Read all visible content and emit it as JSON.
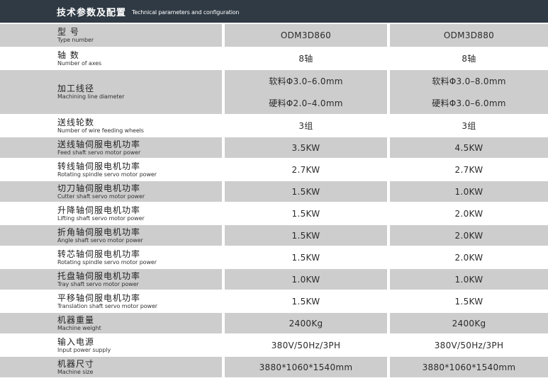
{
  "header": {
    "title_zh": "技术参数及配置",
    "title_en": "Technical parameters and configuration"
  },
  "rows": [
    {
      "zh": "型  号",
      "en": "Type number",
      "v1": [
        "ODM3D860"
      ],
      "v2": [
        "ODM3D880"
      ]
    },
    {
      "zh": "轴  数",
      "en": "Number of axes",
      "v1": [
        "8轴"
      ],
      "v2": [
        "8轴"
      ]
    },
    {
      "zh": "加工线径",
      "en": "Machining line diameter",
      "v1": [
        "软料Φ3.0–6.0mm",
        "硬料Φ2.0–4.0mm"
      ],
      "v2": [
        "软料Φ3.0–8.0mm",
        "硬料Φ3.0–6.0mm"
      ]
    },
    {
      "zh": "送线轮数",
      "en": "Number of wire feeding wheels",
      "v1": [
        "3组"
      ],
      "v2": [
        "3组"
      ]
    },
    {
      "zh": "送线轴伺服电机功率",
      "en": "Feed shaft servo motor power",
      "v1": [
        "3.5KW"
      ],
      "v2": [
        "4.5KW"
      ]
    },
    {
      "zh": "转线轴伺服电机功率",
      "en": "Rotating spindle servo motor power",
      "v1": [
        "2.7KW"
      ],
      "v2": [
        "2.7KW"
      ]
    },
    {
      "zh": "切刀轴伺服电机功率",
      "en": "Cutter shaft servo motor power",
      "v1": [
        "1.5KW"
      ],
      "v2": [
        "1.0KW"
      ]
    },
    {
      "zh": "升降轴伺服电机功率",
      "en": "Lifting shaft servo motor power",
      "v1": [
        "1.5KW"
      ],
      "v2": [
        "2.0KW"
      ]
    },
    {
      "zh": "折角轴伺服电机功率",
      "en": "Angle shaft servo motor power",
      "v1": [
        "1.5KW"
      ],
      "v2": [
        "2.0KW"
      ]
    },
    {
      "zh": "转芯轴伺服电机功率",
      "en": "Rotating spindle servo motor power",
      "v1": [
        "1.5KW"
      ],
      "v2": [
        "2.0KW"
      ]
    },
    {
      "zh": "托盘轴伺服电机功率",
      "en": "Tray shaft servo motor power",
      "v1": [
        "1.0KW"
      ],
      "v2": [
        "1.0KW"
      ]
    },
    {
      "zh": "平移轴伺服电机功率",
      "en": "Translation shaft servo motor power",
      "v1": [
        "1.5KW"
      ],
      "v2": [
        "1.5KW"
      ]
    },
    {
      "zh": "机器重量",
      "en": "Machine weight",
      "v1": [
        "2400Kg"
      ],
      "v2": [
        "2400Kg"
      ]
    },
    {
      "zh": "输入电源",
      "en": "Input power supply",
      "v1": [
        "380V/50Hz/3PH"
      ],
      "v2": [
        "380V/50Hz/3PH"
      ]
    },
    {
      "zh": "机器尺寸",
      "en": "Machine size",
      "v1": [
        "3880*1060*1540mm"
      ],
      "v2": [
        "3880*1060*1540mm"
      ]
    }
  ]
}
